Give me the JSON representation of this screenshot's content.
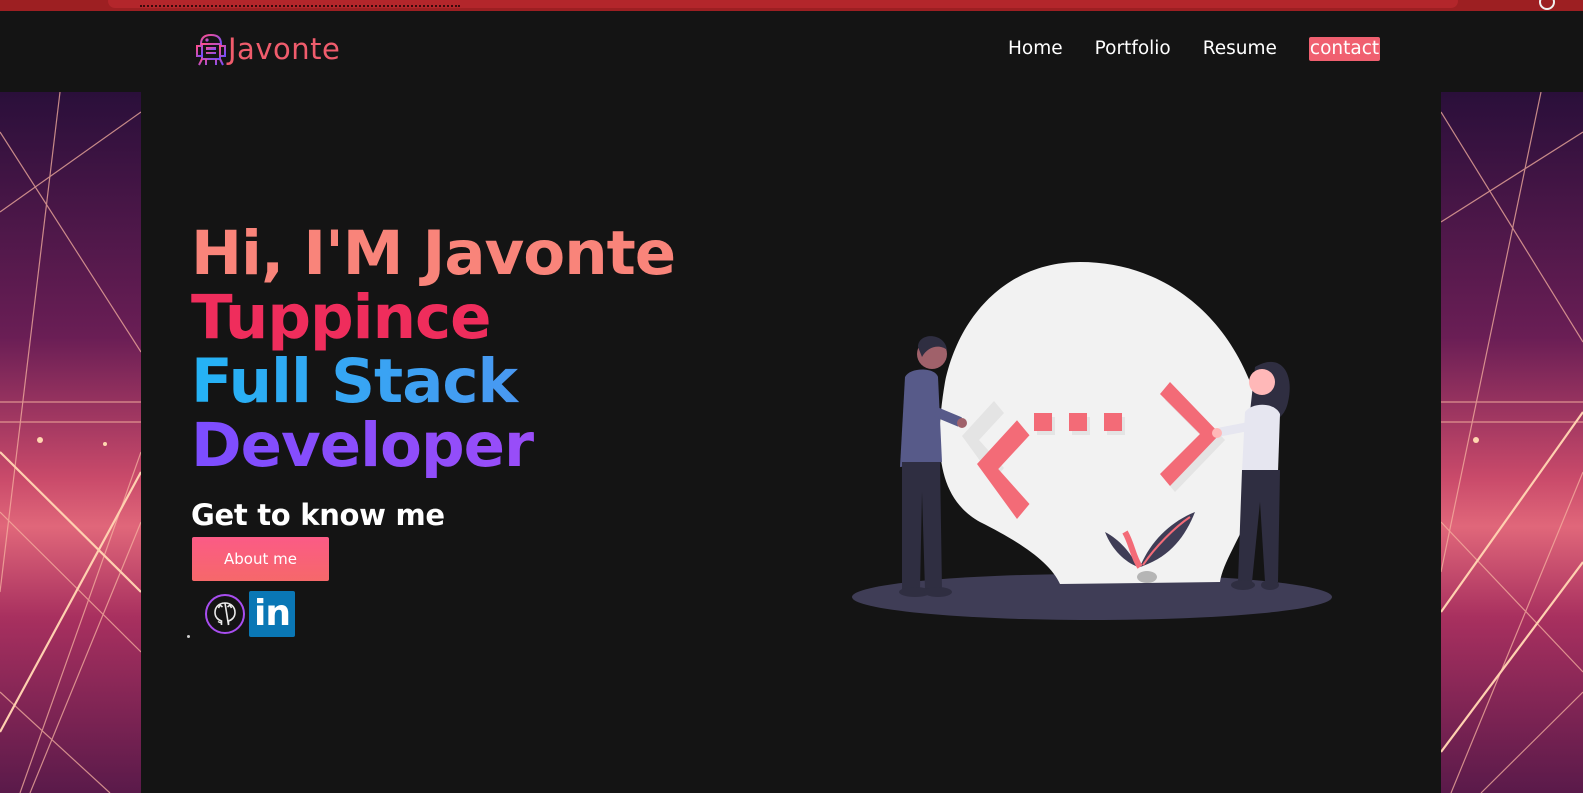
{
  "brand": {
    "name": "Javonte",
    "logo_icon": "robot-icon",
    "color": "#f05c6c"
  },
  "nav": {
    "items": [
      "Home",
      "Portfolio",
      "Resume"
    ],
    "contact": "contact",
    "contact_bg": "#f06070"
  },
  "hero": {
    "line1": "Hi, I'M Javonte",
    "line2": "Tuppince",
    "line3": "Full Stack",
    "line4": "Developer",
    "subtitle": "Get to know me",
    "button_label": "About me"
  },
  "social": {
    "github_icon": "github-icon",
    "linkedin_icon": "linkedin-icon",
    "linkedin_text": "in"
  },
  "colors": {
    "background": "#141414",
    "line1": "#f9847a",
    "line2": "#ef2d5c",
    "line3": "#24b3f5",
    "line4": "#8b4dff",
    "accent": "#f6646c"
  }
}
